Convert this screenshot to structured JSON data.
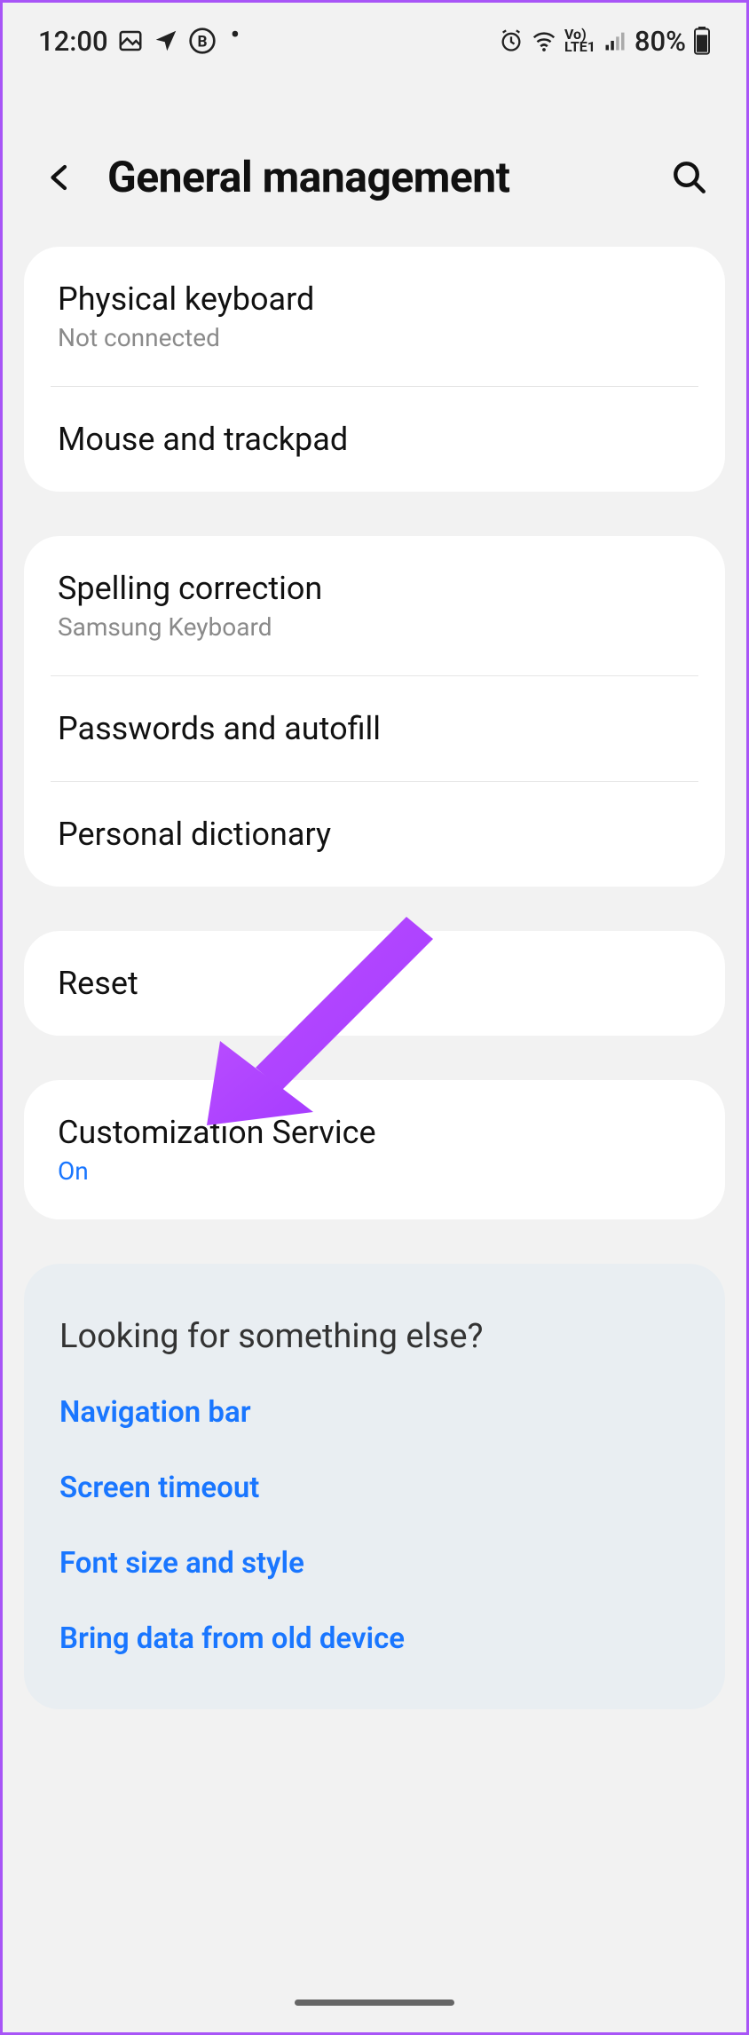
{
  "status": {
    "time": "12:00",
    "battery": "80%"
  },
  "header": {
    "title": "General management"
  },
  "groups": [
    {
      "items": [
        {
          "title": "Physical keyboard",
          "sub": "Not connected"
        },
        {
          "title": "Mouse and trackpad"
        }
      ]
    },
    {
      "items": [
        {
          "title": "Spelling correction",
          "sub": "Samsung Keyboard"
        },
        {
          "title": "Passwords and autofill"
        },
        {
          "title": "Personal dictionary"
        }
      ]
    },
    {
      "items": [
        {
          "title": "Reset"
        }
      ]
    },
    {
      "items": [
        {
          "title": "Customization Service",
          "sub": "On",
          "subBlue": true
        }
      ]
    }
  ],
  "lookingFor": {
    "title": "Looking for something else?",
    "links": [
      "Navigation bar",
      "Screen timeout",
      "Font size and style",
      "Bring data from old device"
    ]
  }
}
